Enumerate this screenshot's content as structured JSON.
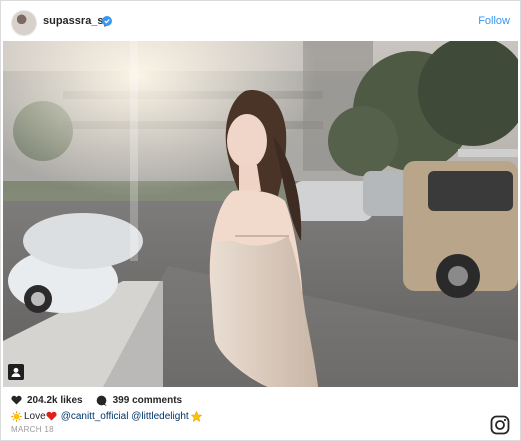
{
  "header": {
    "username": "supassra_sp",
    "follow_label": "Follow"
  },
  "stats": {
    "likes": "204.2k likes",
    "comments": "399 comments"
  },
  "caption": {
    "love": "Love",
    "mention1": "@canitt_official",
    "mention2": "@littledelight"
  },
  "date": "MARCH 18",
  "colors": {
    "accent": "#3897f0",
    "verified": "#3897f0",
    "heart_red": "#e0201c"
  },
  "icons": [
    "verified-badge-icon",
    "user-tag-icon",
    "heart-icon",
    "comment-icon",
    "sun-emoji-icon",
    "red-heart-emoji-icon",
    "star-emoji-icon",
    "instagram-logo-icon"
  ]
}
